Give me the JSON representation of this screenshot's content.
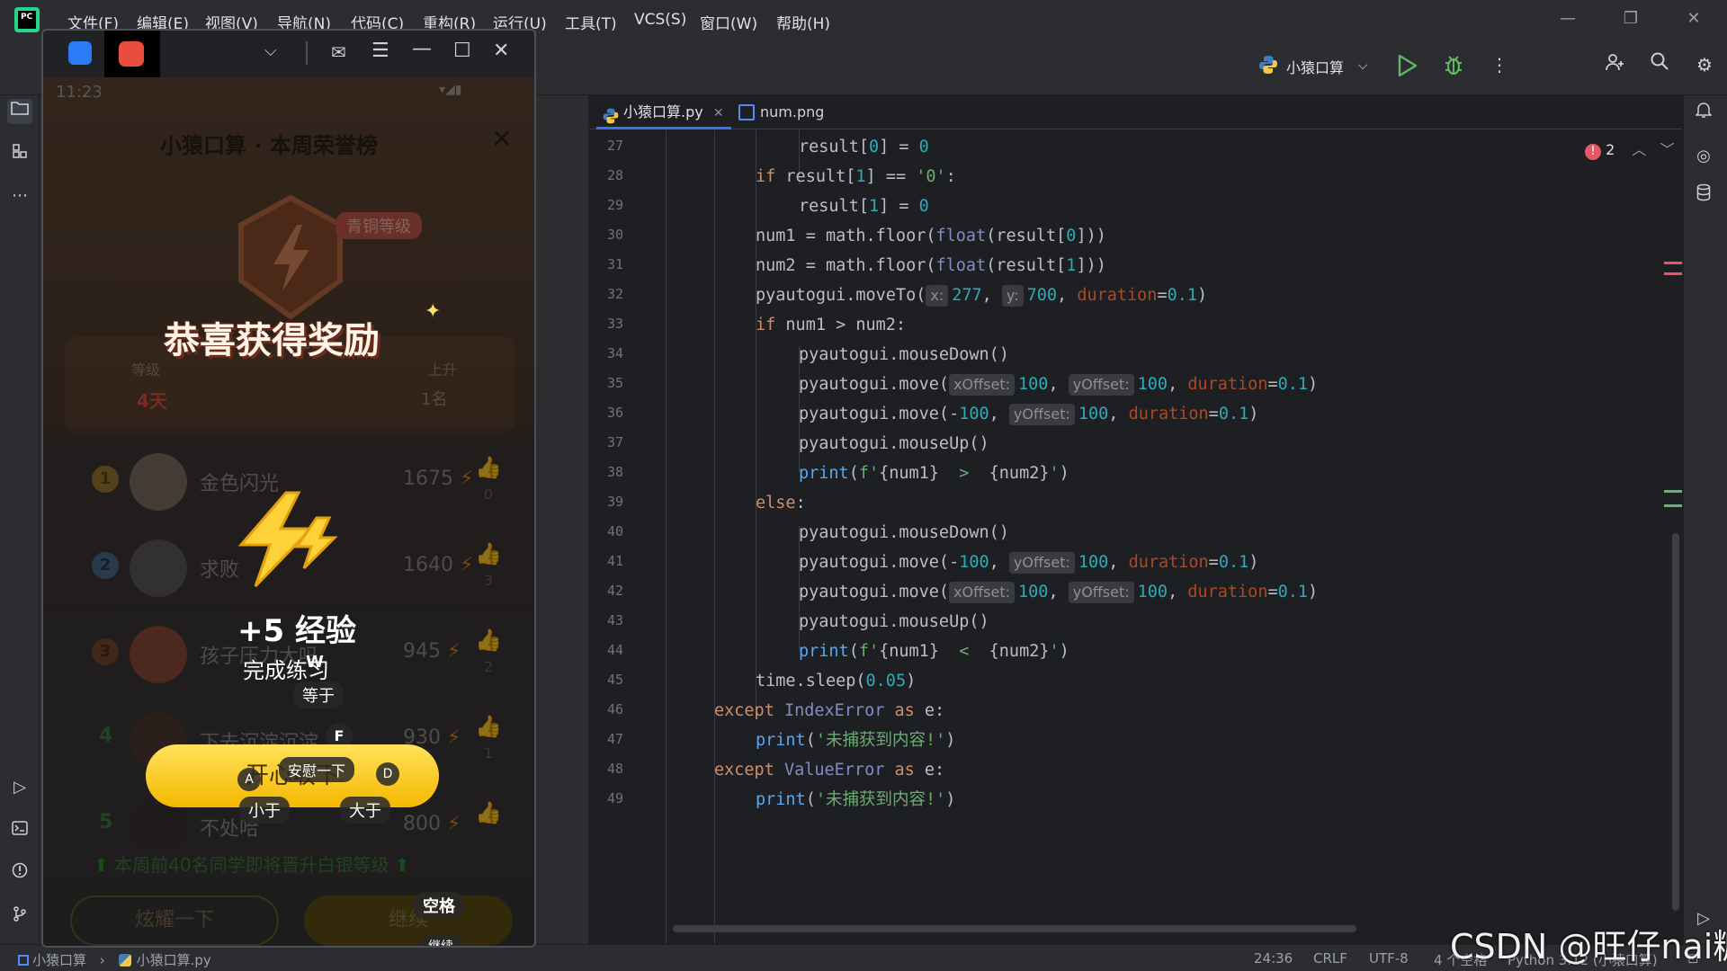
{
  "ide": {
    "menu": [
      "文件(F)",
      "编辑(E)",
      "视图(V)",
      "导航(N)",
      "代码(C)",
      "重构(R)",
      "运行(U)",
      "工具(T)",
      "VCS(S)",
      "窗口(W)",
      "帮助(H)"
    ],
    "logo_text": "PC",
    "run_config": "小猿口算",
    "tabs": [
      {
        "label": "小猿口算.py",
        "icon": "python-file-icon",
        "active": true
      },
      {
        "label": "num.png",
        "icon": "image-file-icon",
        "active": false
      }
    ],
    "inspections": {
      "errors": "2"
    },
    "lines": [
      "27",
      "28",
      "29",
      "30",
      "31",
      "32",
      "33",
      "34",
      "35",
      "36",
      "37",
      "38",
      "39",
      "40",
      "41",
      "42",
      "43",
      "44",
      "45",
      "46",
      "47",
      "48",
      "49"
    ],
    "breadcrumb": [
      "小猿口算",
      "小猿口算.py"
    ],
    "status": {
      "position": "24:36",
      "line_sep": "CRLF",
      "encoding": "UTF-8",
      "indent": "4 个空格",
      "interpreter": "Python 3.12 (小猿口算)"
    },
    "watermark": "CSDN @旺仔nai糖"
  },
  "code_tokens": {
    "l27": [
      "result[",
      "0",
      "] = ",
      "0"
    ],
    "l28": [
      "if",
      " result[",
      "1",
      "] == ",
      "'0'",
      ":"
    ],
    "l29": [
      "result[",
      "1",
      "] = ",
      "0"
    ],
    "l30": [
      "num1 = math.floor(",
      "float",
      "(result[",
      "0",
      "]))"
    ],
    "l31": [
      "num2 = math.floor(",
      "float",
      "(result[",
      "1",
      "]))"
    ],
    "l32": [
      "pyautogui.moveTo(",
      "x:",
      "277",
      ", ",
      "y:",
      "700",
      ", ",
      "duration",
      "=",
      "0.1",
      ")"
    ],
    "l33": [
      "if",
      " num1 > num2:"
    ],
    "l34": [
      "pyautogui.mouseDown()"
    ],
    "l35": [
      "pyautogui.move(",
      "xOffset:",
      "100",
      ", ",
      "yOffset:",
      "100",
      ", ",
      "duration",
      "=",
      "0.1",
      ")"
    ],
    "l36": [
      "pyautogui.move(-",
      "100",
      ", ",
      "yOffset:",
      "100",
      ", ",
      "duration",
      "=",
      "0.1",
      ")"
    ],
    "l37": [
      "pyautogui.mouseUp()"
    ],
    "l38": [
      "print",
      "(",
      "f'",
      "{num1}",
      "  >  ",
      "{num2}",
      "'",
      ")"
    ],
    "l39": [
      "else",
      ":"
    ],
    "l40": [
      "pyautogui.mouseDown()"
    ],
    "l41": [
      "pyautogui.move(-",
      "100",
      ", ",
      "yOffset:",
      "100",
      ", ",
      "duration",
      "=",
      "0.1",
      ")"
    ],
    "l42": [
      "pyautogui.move(",
      "xOffset:",
      "100",
      ", ",
      "yOffset:",
      "100",
      ", ",
      "duration",
      "=",
      "0.1",
      ")"
    ],
    "l43": [
      "pyautogui.mouseUp()"
    ],
    "l44": [
      "print",
      "(",
      "f'",
      "{num1}",
      "  <  ",
      "{num2}",
      "'",
      ")"
    ],
    "l45": [
      "time.sleep(",
      "0.05",
      ")"
    ],
    "l46": [
      "except",
      " IndexError ",
      "as",
      " e:"
    ],
    "l47": [
      "print",
      "(",
      "'未捕获到内容!'",
      ")"
    ],
    "l48": [
      "except",
      " ValueError ",
      "as",
      " e:"
    ],
    "l49": [
      "print",
      "(",
      "'未捕获到内容!'",
      ")"
    ]
  },
  "phone": {
    "time": "11:23",
    "title": "小猿口算 · 本周荣誉榜",
    "tier_badge": "青铜等级",
    "reward_title": "恭喜获得奖励",
    "stat_left_label": "等级",
    "stat_left_value": "4天",
    "stat_right_label": "上升",
    "stat_right_value": "1名",
    "ranks": [
      {
        "pos": "1",
        "name": "金色闪光",
        "score": "1675",
        "likes": "0"
      },
      {
        "pos": "2",
        "name": "求败",
        "score": "1640",
        "likes": "3"
      },
      {
        "pos": "3",
        "name": "孩子压力大吗",
        "score": "945",
        "likes": "2"
      },
      {
        "pos": "4",
        "name": "下去沉淀沉淀",
        "score": "930",
        "likes": "1"
      },
      {
        "pos": "5",
        "name": "不处哈",
        "score": "800",
        "likes": ""
      }
    ],
    "exp": "+5 经验",
    "exp_sub": "完成练习",
    "key_w": "W",
    "key_equal": "等于",
    "key_f": "F",
    "collect_btn": "开心收下",
    "comfort": "安慰一下",
    "key_d": "D",
    "key_a": "A",
    "key_less": "小于",
    "key_greater": "大于",
    "promo": "本周前40名同学即将晋升白银等级",
    "show_off": "炫耀一下",
    "continue": "继续",
    "key_space": "空格",
    "key_continue": "继续"
  }
}
